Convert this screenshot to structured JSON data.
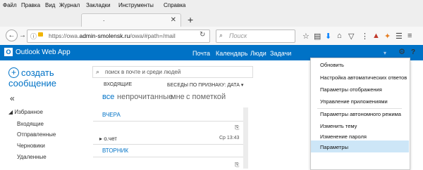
{
  "browser": {
    "menu": [
      "Файл",
      "Правка",
      "Вид",
      "Журнал",
      "Закладки",
      "Инструменты",
      "Справка"
    ],
    "tab_title": ".",
    "address_scheme": "https://owa.",
    "address_host": "admin-smolensk.ru",
    "address_path": "/owa/#path=/mail",
    "search_placeholder": "Поиск"
  },
  "owa": {
    "app_title": "Outlook Web App",
    "nav": [
      "Почта",
      "Календарь",
      "Люди",
      "Задачи"
    ],
    "new_mail_line1": "создать",
    "new_mail_line2": "сообщение",
    "search_placeholder": "поиск в почте и среди людей",
    "inbox_label": "ВХОДЯЩИЕ",
    "conv_label": "БЕСЕДЫ ПО ПРИЗНАКУ: ДАТА",
    "filters": [
      "все",
      "непрочитанные",
      "мне",
      "с пометкой"
    ],
    "favorites_label": "Избранное",
    "folders": [
      "Входящие",
      "Отправленные",
      "Черновики",
      "Удаленные"
    ],
    "groups": [
      "ВЧЕРА",
      "ВТОРНИК"
    ],
    "message": {
      "from": "о.чет",
      "time": "Ср 13:43"
    }
  },
  "settings_menu": [
    "Обновить",
    "Настройка автоматических ответов",
    "Параметры отображения",
    "Управление приложениями",
    "Параметры автономного режима",
    "Изменить тему",
    "Изменение пароля",
    "Параметры"
  ],
  "colors": {
    "owa_blue": "#0072c6",
    "menu_highlight": "#cde6f7"
  }
}
